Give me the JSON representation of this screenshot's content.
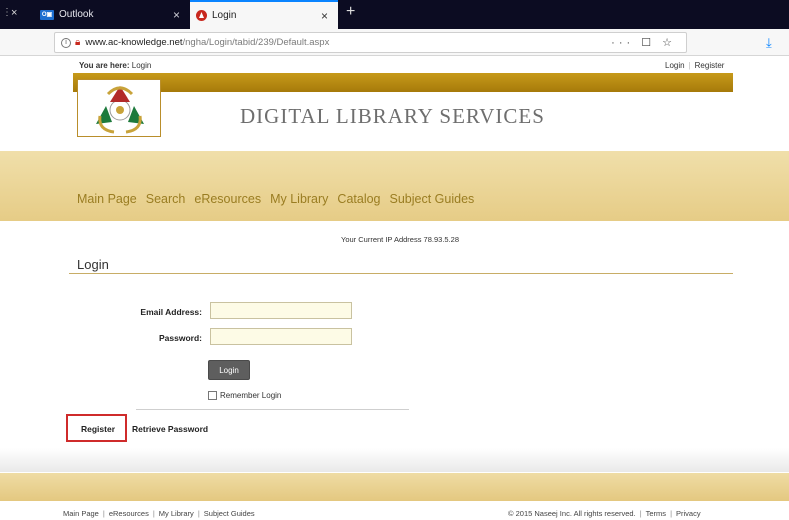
{
  "browser": {
    "tabs": [
      {
        "label": "Outlook",
        "icon": "outlook-icon"
      },
      {
        "label": "Login",
        "icon": "login-site-icon"
      }
    ],
    "url": {
      "host": "www.ac-knowledge.net",
      "path": "/ngha/Login/tabid/239/Default.aspx"
    },
    "new_tab_glyph": "+",
    "close_glyph": "×",
    "actions_glyph": "··· ☐ ☆",
    "download_glyph": "⤓"
  },
  "page": {
    "breadcrumb_label": "You are here:",
    "breadcrumb_value": "Login",
    "top_links": {
      "login": "Login",
      "register": "Register"
    },
    "site_title": "DIGITAL LIBRARY SERVICES",
    "menu": [
      "Main Page",
      "Search",
      "eResources",
      "My Library",
      "Catalog",
      "Subject Guides"
    ],
    "ip_text": "Your Current IP Address 78.93.5.28",
    "login_heading": "Login",
    "form": {
      "email_label": "Email Address:",
      "email_value": "",
      "password_label": "Password:",
      "password_value": "",
      "login_button": "Login",
      "remember_label": "Remember Login",
      "remember_checked": false
    },
    "links": {
      "register": "Register",
      "retrieve": "Retrieve Password"
    },
    "footer": {
      "left": [
        "Main Page",
        "eResources",
        "My Library",
        "Subject Guides"
      ],
      "copyright": "© 2015 Naseej Inc. All rights reserved.",
      "terms": "Terms",
      "privacy": "Privacy"
    }
  },
  "colors": {
    "gold": "#c79a1a",
    "menu_band": "#ecd69a",
    "menu_text": "#9a7d22",
    "highlight": "#cf2b2b"
  }
}
